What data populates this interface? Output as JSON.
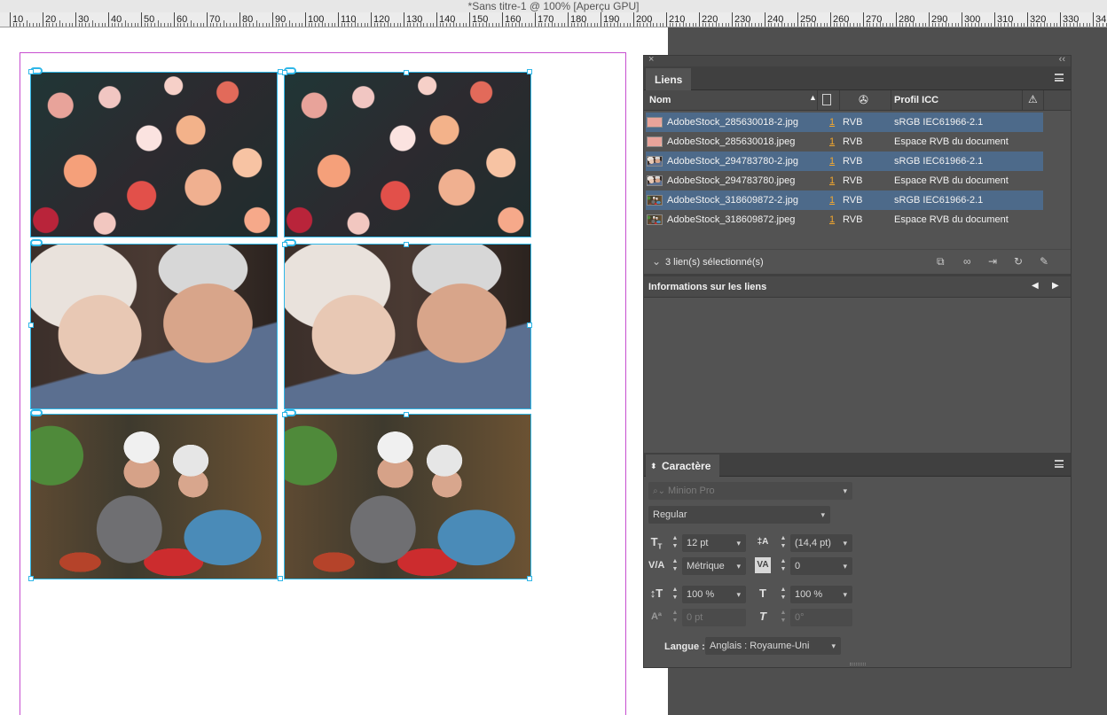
{
  "window": {
    "title": "*Sans titre-1 @ 100% [Aperçu GPU]"
  },
  "ruler": {
    "labels": [
      "10",
      "20",
      "30",
      "40",
      "50",
      "60",
      "70",
      "80",
      "90",
      "100",
      "110",
      "120",
      "130",
      "140",
      "150",
      "160",
      "170",
      "180",
      "190",
      "200",
      "210",
      "220",
      "230",
      "240",
      "250",
      "260",
      "270",
      "280",
      "290",
      "300",
      "310",
      "320",
      "330",
      "34"
    ]
  },
  "canvas": {
    "images": [
      "flowers",
      "elderly-couple-forehead",
      "elderly-couple-cooking"
    ]
  },
  "links_panel": {
    "tab_label": "Liens",
    "columns": {
      "name": "Nom",
      "icc": "Profil ICC"
    },
    "rows": [
      {
        "name": "AdobeStock_285630018-2.jpg",
        "page": "1",
        "color": "RVB",
        "icc": "sRGB IEC61966-2.1",
        "selected": true,
        "thumb": "flowers"
      },
      {
        "name": "AdobeStock_285630018.jpeg",
        "page": "1",
        "color": "RVB",
        "icc": "Espace RVB du document",
        "selected": false,
        "thumb": "flowers"
      },
      {
        "name": "AdobeStock_294783780-2.jpg",
        "page": "1",
        "color": "RVB",
        "icc": "sRGB IEC61966-2.1",
        "selected": true,
        "thumb": "couple"
      },
      {
        "name": "AdobeStock_294783780.jpeg",
        "page": "1",
        "color": "RVB",
        "icc": "Espace RVB du document",
        "selected": false,
        "thumb": "couple"
      },
      {
        "name": "AdobeStock_318609872-2.jpg",
        "page": "1",
        "color": "RVB",
        "icc": "sRGB IEC61966-2.1",
        "selected": true,
        "thumb": "cooking"
      },
      {
        "name": "AdobeStock_318609872.jpeg",
        "page": "1",
        "color": "RVB",
        "icc": "Espace RVB du document",
        "selected": false,
        "thumb": "cooking"
      }
    ],
    "selection_status": "3 lien(s) sélectionné(s)",
    "info_title": "Informations sur les liens"
  },
  "character_panel": {
    "tab_label": "Caractère",
    "font_family": "Minion Pro",
    "font_style": "Regular",
    "font_size": "12 pt",
    "leading": "(14,4 pt)",
    "kerning": "Métrique",
    "tracking": "0",
    "vertical_scale": "100 %",
    "horizontal_scale": "100 %",
    "baseline_shift": "0 pt",
    "skew": "0°",
    "language_label": "Langue :",
    "language": "Anglais : Royaume-Uni"
  },
  "colors": {
    "frame": "#2fb7e8",
    "margin": "#c74fd0",
    "selection": "#4d6a8a",
    "page_link": "#f2a72e"
  }
}
